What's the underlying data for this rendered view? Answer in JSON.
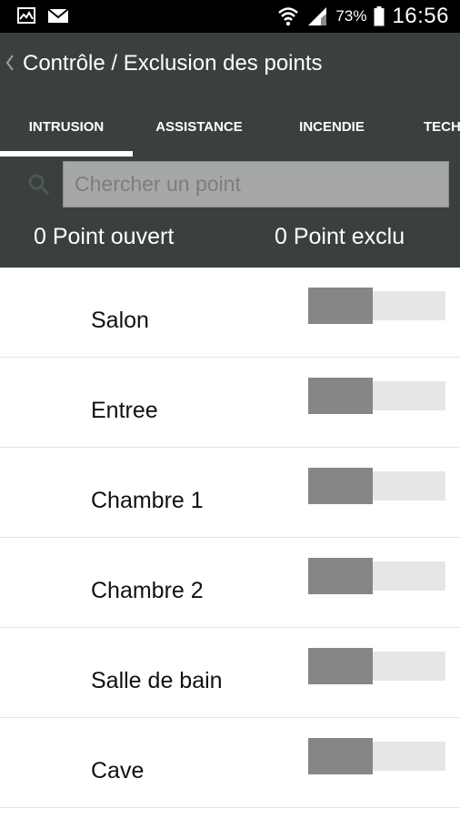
{
  "status_bar": {
    "icons": [
      "gallery-icon",
      "email-icon",
      "wifi-icon",
      "signal-icon",
      "battery-icon"
    ],
    "battery": "73%",
    "time": "16:56"
  },
  "header": {
    "title": "Contrôle / Exclusion des points",
    "tabs": [
      {
        "label": "INTRUSION",
        "active": true
      },
      {
        "label": "ASSISTANCE",
        "active": false
      },
      {
        "label": "INCENDIE",
        "active": false
      },
      {
        "label": "TECH",
        "active": false
      }
    ],
    "search_placeholder": "Chercher un point",
    "open_count": "0 Point ouvert",
    "excluded_count": "0 Point exclu"
  },
  "points": [
    {
      "label": "Salon",
      "excluded": false
    },
    {
      "label": "Entree",
      "excluded": false
    },
    {
      "label": "Chambre 1",
      "excluded": false
    },
    {
      "label": "Chambre 2",
      "excluded": false
    },
    {
      "label": "Salle de bain",
      "excluded": false
    },
    {
      "label": "Cave",
      "excluded": false
    }
  ],
  "colors": {
    "header_bg": "#3a4040",
    "status_bar_bg": "#000000",
    "search_bg": "#a6a7a7",
    "toggle_thumb": "#868686",
    "toggle_track": "#e6e6e6"
  }
}
